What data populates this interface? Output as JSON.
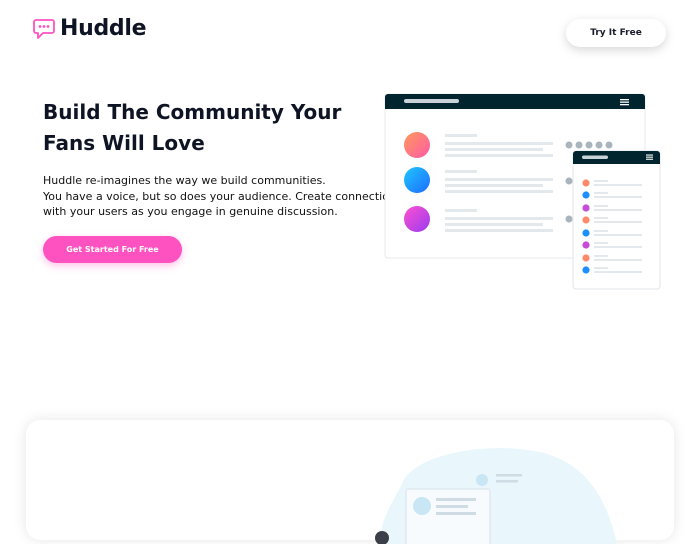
{
  "header": {
    "brand": "Huddle",
    "logo_icon": "chat-bubble-icon",
    "try_button": "Try It Free"
  },
  "hero": {
    "title": "Build The Community Your Fans Will Love",
    "description_lines": [
      "Huddle re-imagines the way we build communities.",
      "You have a voice, but so does your audience. Create connections",
      "with your users as you engage in genuine discussion."
    ],
    "cta_button": "Get Started For Free"
  },
  "colors": {
    "accent": "#ff52c1",
    "dark": "#00252e",
    "text": "#0f1424"
  }
}
